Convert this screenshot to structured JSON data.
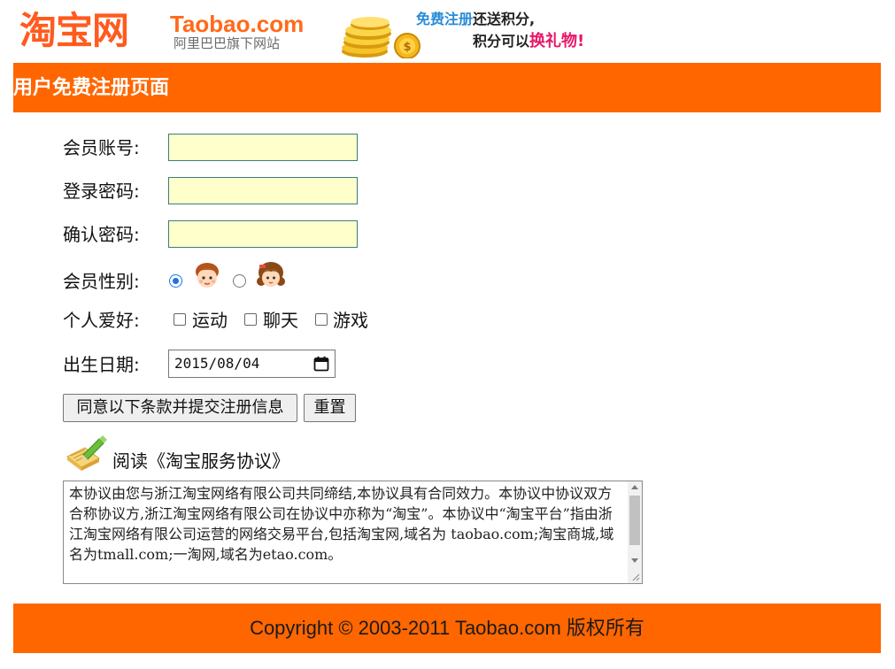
{
  "header": {
    "logo_cn": "淘宝网",
    "logo_en": "Taobao.com",
    "logo_sub": "阿里巴巴旗下网站",
    "promo_line1_highlight": "免费注册",
    "promo_line1_rest": "还送积分,",
    "promo_line2_rest": "积分可以",
    "promo_line2_highlight": "换礼物!"
  },
  "title_bar": {
    "title": "用户免费注册页面"
  },
  "form": {
    "account_label": "会员账号:",
    "password_label": "登录密码:",
    "confirm_label": "确认密码:",
    "gender_label": "会员性别:",
    "gender_selected": "male",
    "hobby_label": "个人爱好:",
    "hobbies": [
      {
        "label": "运动",
        "checked": false
      },
      {
        "label": "聊天",
        "checked": false
      },
      {
        "label": "游戏",
        "checked": false
      }
    ],
    "birthday_label": "出生日期:",
    "birthday_value": "2015/08/04",
    "submit_label": "同意以下条款并提交注册信息",
    "reset_label": "重置"
  },
  "agreement": {
    "title": "阅读《淘宝服务协议》",
    "text": "本协议由您与浙江淘宝网络有限公司共同缔结,本协议具有合同效力。本协议中协议双方合称协议方,浙江淘宝网络有限公司在协议中亦称为“淘宝”。本协议中“淘宝平台”指由浙江淘宝网络有限公司运营的网络交易平台,包括淘宝网,域名为 taobao.com;淘宝商城,域名为tmall.com;一淘网,域名为etao.com。"
  },
  "footer": {
    "copyright": "Copyright © 2003-2011 Taobao.com 版权所有"
  },
  "colors": {
    "brand_orange": "#ff6600",
    "input_bg": "#ffffcc",
    "promo_blue": "#2a8bd6",
    "promo_pink": "#e8166a"
  }
}
